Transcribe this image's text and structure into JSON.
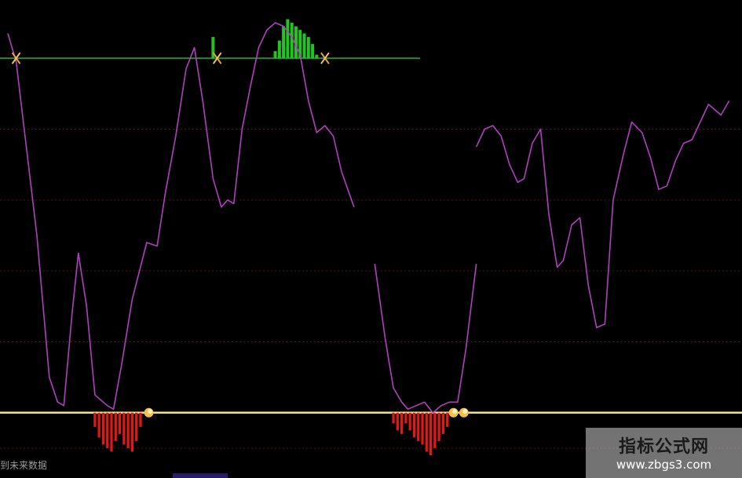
{
  "chart_data": {
    "type": "line",
    "background": "#000000",
    "grid": true,
    "grid_color": "#5a1414",
    "line_color": "#b040c0",
    "upper_line": {
      "value": 100,
      "color": "#2e8b2e"
    },
    "lower_line": {
      "value": 0,
      "color": "#f2e08a"
    },
    "ylim": [
      -12,
      112
    ],
    "series": [
      {
        "segments": [
          [
            [
              0,
              107
            ],
            [
              4,
              99
            ],
            [
              14,
              50
            ],
            [
              20,
              10
            ],
            [
              24,
              3
            ],
            [
              27,
              2
            ],
            [
              31,
              28
            ],
            [
              34,
              45
            ],
            [
              38,
              30
            ],
            [
              42,
              5
            ],
            [
              48,
              2
            ],
            [
              51,
              1
            ],
            [
              55,
              14
            ],
            [
              60,
              32
            ],
            [
              67,
              48
            ],
            [
              72,
              47
            ],
            [
              76,
              62
            ],
            [
              81,
              78
            ],
            [
              86,
              97
            ],
            [
              90,
              103
            ],
            [
              94,
              88
            ],
            [
              99,
              66
            ],
            [
              103,
              58
            ],
            [
              106,
              60
            ],
            [
              109,
              59
            ],
            [
              113,
              80
            ],
            [
              117,
              92
            ],
            [
              121,
              103
            ],
            [
              125,
              108
            ],
            [
              129,
              110
            ],
            [
              133,
              109
            ],
            [
              137,
              106
            ],
            [
              141,
              101
            ],
            [
              145,
              88
            ],
            [
              149,
              79
            ],
            [
              153,
              81
            ],
            [
              157,
              78
            ],
            [
              161,
              68
            ],
            [
              167,
              58
            ]
          ],
          [
            [
              177,
              42
            ],
            [
              182,
              21
            ],
            [
              186,
              7
            ],
            [
              190,
              3
            ],
            [
              193,
              1
            ],
            [
              197,
              2
            ],
            [
              201,
              3
            ],
            [
              205,
              0
            ],
            [
              209,
              2
            ],
            [
              213,
              3
            ],
            [
              217,
              3
            ],
            [
              221,
              18
            ],
            [
              226,
              42
            ]
          ],
          [
            [
              226,
              75
            ],
            [
              230,
              80
            ],
            [
              234,
              81
            ],
            [
              238,
              78
            ],
            [
              242,
              70
            ],
            [
              246,
              65
            ],
            [
              249,
              66
            ],
            [
              253,
              76
            ],
            [
              257,
              80
            ],
            [
              261,
              56
            ],
            [
              265,
              41
            ],
            [
              268,
              43
            ],
            [
              272,
              53
            ],
            [
              276,
              55
            ],
            [
              280,
              36
            ],
            [
              284,
              24
            ],
            [
              288,
              25
            ],
            [
              292,
              60
            ],
            [
              297,
              73
            ],
            [
              301,
              82
            ],
            [
              306,
              79
            ],
            [
              310,
              72
            ],
            [
              314,
              63
            ],
            [
              318,
              64
            ],
            [
              322,
              71
            ],
            [
              326,
              76
            ],
            [
              330,
              77
            ],
            [
              334,
              82
            ],
            [
              338,
              87
            ],
            [
              344,
              84
            ],
            [
              348,
              88
            ]
          ]
        ]
      }
    ],
    "up_bars": {
      "color": "#22c422",
      "x": [
        99,
        129,
        131,
        133,
        135,
        137,
        139,
        141,
        143,
        145,
        147,
        149
      ],
      "values": [
        106,
        102,
        105,
        109,
        111,
        110,
        109,
        108,
        107,
        106,
        104,
        101
      ]
    },
    "down_bars": {
      "color": "#e01818",
      "x": [
        42,
        44,
        46,
        48,
        50,
        52,
        54,
        56,
        58,
        60,
        62,
        64,
        186,
        188,
        190,
        192,
        194,
        196,
        198,
        200,
        202,
        204,
        206,
        208,
        210,
        212
      ],
      "values": [
        -4,
        -7,
        -9,
        -10,
        -11,
        -8,
        -6,
        -9,
        -10,
        -11,
        -8,
        -4,
        -3,
        -5,
        -6,
        -3,
        -5,
        -7,
        -8,
        -9,
        -11,
        -12,
        -10,
        -8,
        -6,
        -4
      ]
    },
    "upper_markers": [
      4,
      101,
      153
    ],
    "lower_markers": [
      68,
      215,
      220
    ]
  },
  "footer": {
    "note": "到未来数据"
  },
  "watermark": {
    "title": "指标公式网",
    "url": "www.zbgs3.com"
  }
}
